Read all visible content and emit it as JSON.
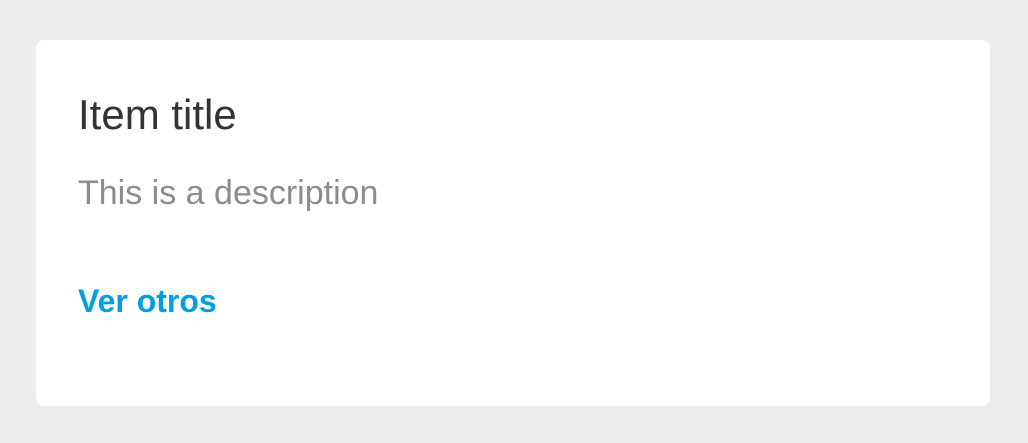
{
  "card": {
    "title": "Item title",
    "description": "This is a description",
    "link_label": "Ver otros"
  },
  "colors": {
    "page_background": "#eeeeee",
    "card_background": "#ffffff",
    "title_text": "#333333",
    "description_text": "#8c8c8c",
    "link_accent": "#009ee3"
  }
}
